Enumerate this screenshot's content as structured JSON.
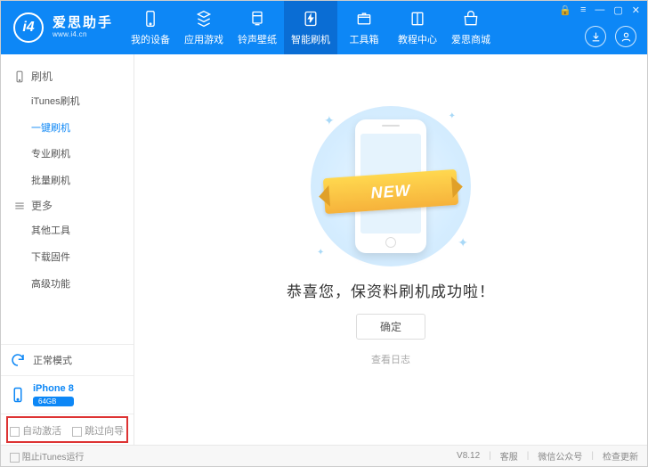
{
  "app": {
    "name_cn": "爱思助手",
    "name_en": "www.i4.cn",
    "logo_text": "i4"
  },
  "win_ctrls": {
    "lock": "🔒",
    "menu": "≡",
    "min": "—",
    "max": "▢",
    "close": "✕"
  },
  "nav": [
    {
      "icon": "phone",
      "label": "我的设备"
    },
    {
      "icon": "apps",
      "label": "应用游戏"
    },
    {
      "icon": "ring",
      "label": "铃声壁纸"
    },
    {
      "icon": "flash",
      "label": "智能刷机",
      "active": true
    },
    {
      "icon": "tools",
      "label": "工具箱"
    },
    {
      "icon": "book",
      "label": "教程中心"
    },
    {
      "icon": "shop",
      "label": "爱思商城"
    }
  ],
  "hdr_icons": {
    "download": "↓",
    "user": "◌"
  },
  "sidebar": {
    "groups": [
      {
        "label": "刷机",
        "icon": "phone",
        "items": [
          {
            "label": "iTunes刷机"
          },
          {
            "label": "一键刷机",
            "active": true
          },
          {
            "label": "专业刷机"
          },
          {
            "label": "批量刷机"
          }
        ]
      },
      {
        "label": "更多",
        "icon": "more",
        "items": [
          {
            "label": "其他工具"
          },
          {
            "label": "下载固件"
          },
          {
            "label": "高级功能"
          }
        ]
      }
    ],
    "mode": {
      "label": "正常模式",
      "icon": "refresh"
    },
    "device": {
      "name": "iPhone 8",
      "storage": "64GB",
      "icon": "phone"
    },
    "checks": {
      "auto_activate": "自动激活",
      "skip_wizard": "跳过向导"
    }
  },
  "content": {
    "ribbon_text": "NEW",
    "title": "恭喜您，保资料刷机成功啦！",
    "ok_label": "确定",
    "log_link": "查看日志"
  },
  "footer": {
    "block_itunes": "阻止iTunes运行",
    "version": "V8.12",
    "support": "客服",
    "wechat": "微信公众号",
    "update": "检查更新"
  }
}
